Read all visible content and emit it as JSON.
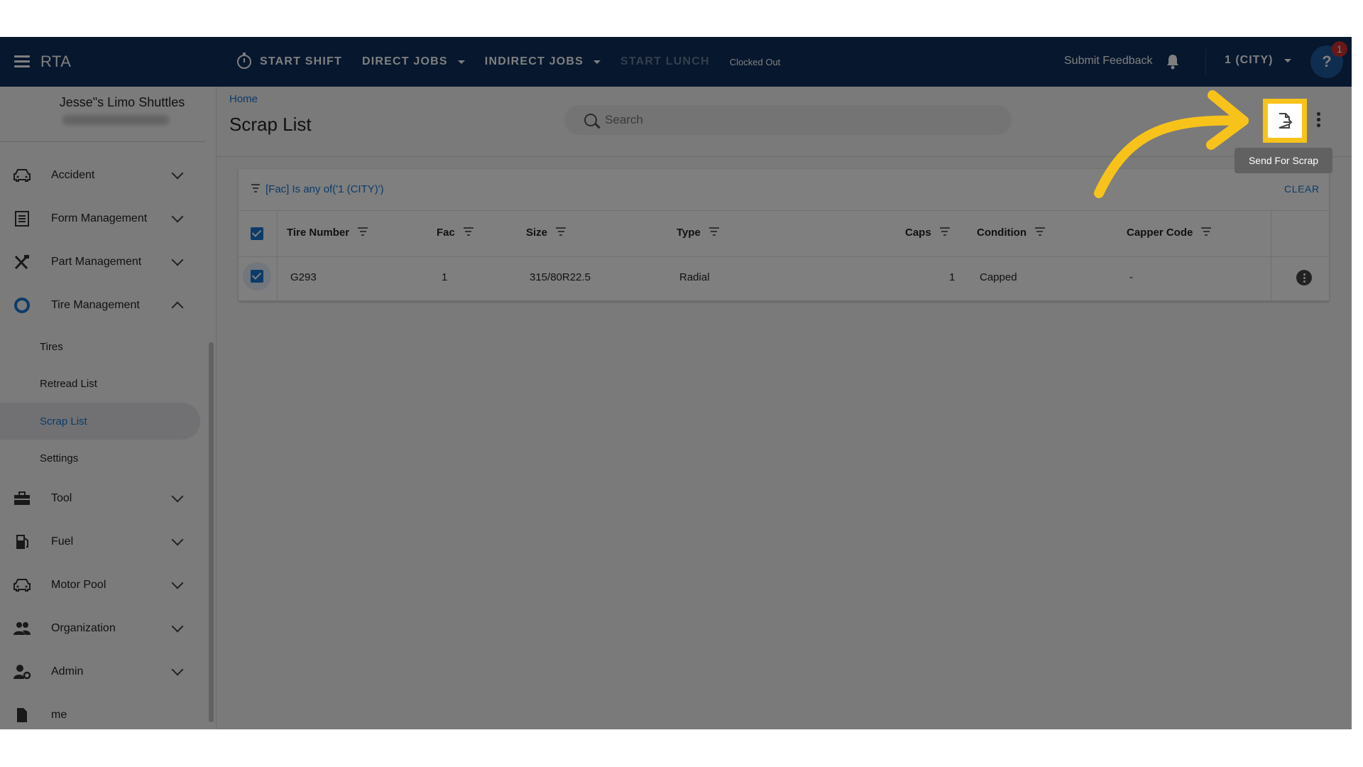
{
  "topbar": {
    "app_title": "RTA",
    "nav": [
      {
        "label": "START SHIFT"
      },
      {
        "label": "DIRECT JOBS"
      },
      {
        "label": "INDIRECT JOBS"
      },
      {
        "label": "START LUNCH"
      }
    ],
    "clock_status": "Clocked Out",
    "feedback_label": "Submit Feedback",
    "org_label": "1 (CITY)",
    "notification_count": "1",
    "avatar_glyph": "?",
    "color": "#0d2e5c"
  },
  "sidebar": {
    "company": "Jesse\"s Limo Shuttles",
    "items": [
      {
        "label": "Accident",
        "icon": "car-icon"
      },
      {
        "label": "Form Management",
        "icon": "form-icon"
      },
      {
        "label": "Part Management",
        "icon": "tools-icon"
      },
      {
        "label": "Tire Management",
        "icon": "tire-icon",
        "expanded": true
      },
      {
        "label": "Tool",
        "icon": "toolbox-icon"
      },
      {
        "label": "Fuel",
        "icon": "fuel-pump-icon"
      },
      {
        "label": "Motor Pool",
        "icon": "car-icon"
      },
      {
        "label": "Organization",
        "icon": "people-icon"
      },
      {
        "label": "Admin",
        "icon": "admin-icon"
      },
      {
        "label": "me",
        "icon": "file-icon"
      }
    ],
    "tire_sub": [
      {
        "label": "Tires"
      },
      {
        "label": "Retread List"
      },
      {
        "label": "Scrap List",
        "active": true
      },
      {
        "label": "Settings"
      }
    ]
  },
  "main": {
    "breadcrumb": "Home",
    "title": "Scrap List",
    "search_placeholder": "Search",
    "tooltip": "Send For Scrap",
    "filter_text": "[Fac] Is any of('1 (CITY)')",
    "clear_label": "CLEAR",
    "columns": [
      "Tire Number",
      "Fac",
      "Size",
      "Type",
      "Caps",
      "Condition",
      "Capper Code"
    ],
    "rows": [
      {
        "tire_number": "G293",
        "fac": "1",
        "size": "315/80R22.5",
        "type": "Radial",
        "caps": "1",
        "condition": "Capped",
        "capper_code": "-"
      }
    ],
    "accent_color": "#1976d2",
    "highlight_color": "#f7c31a"
  }
}
